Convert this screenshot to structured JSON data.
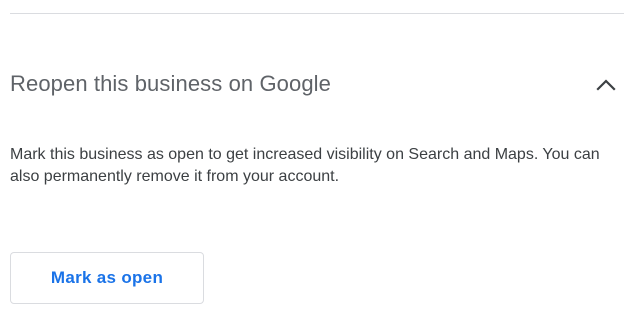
{
  "section": {
    "title": "Reopen this business on Google",
    "toggle_icon": "chevron-up-icon",
    "description": "Mark this business as open to get increased visibility on Search and Maps. You can also permanently remove it from your account.",
    "action_label": "Mark as open"
  },
  "colors": {
    "title": "#5f6368",
    "body_text": "#3c4043",
    "action_text": "#1a73e8",
    "border": "#dadce0"
  }
}
